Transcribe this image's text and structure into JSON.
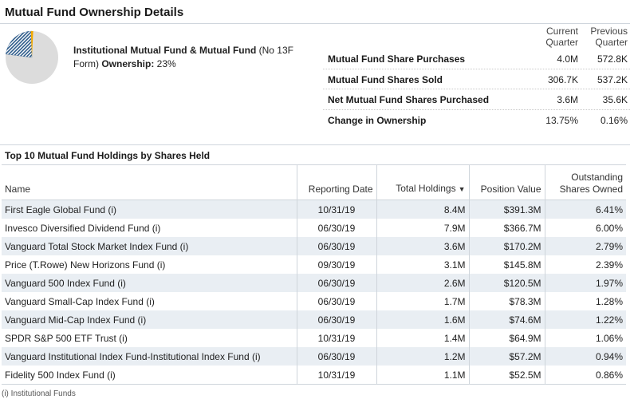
{
  "header": {
    "title": "Mutual Fund Ownership Details"
  },
  "ownership": {
    "label_bold": "Institutional Mutual Fund & Mutual Fund",
    "label_normal": " (No 13F Form) ",
    "label_suffix": "Ownership:",
    "value": " 23%",
    "share_fraction": 0.23,
    "colors": {
      "main": "#dcdcdc",
      "hatch": "#2d5b8a",
      "accent": "#f2a900"
    }
  },
  "summary": {
    "col_current": "Current Quarter",
    "col_current_l1": "Current",
    "col_current_l2": "Quarter",
    "col_previous_l1": "Previous",
    "col_previous_l2": "Quarter",
    "rows": [
      {
        "label": "Mutual Fund Share Purchases",
        "current": "4.0M",
        "previous": "572.8K"
      },
      {
        "label": "Mutual Fund Shares Sold",
        "current": "306.7K",
        "previous": "537.2K"
      },
      {
        "label": "Net Mutual Fund Shares Purchased",
        "current": "3.6M",
        "previous": "35.6K"
      },
      {
        "label": "Change in Ownership",
        "current": "13.75%",
        "previous": "0.16%"
      }
    ]
  },
  "holdings": {
    "title": "Top 10 Mutual Fund Holdings by Shares Held",
    "columns": {
      "name": "Name",
      "date": "Reporting Date",
      "total": "Total Holdings",
      "value": "Position Value",
      "outstanding_l1": "Outstanding",
      "outstanding_l2": "Shares Owned"
    },
    "sort_icon": "sort-down-icon",
    "rows": [
      {
        "name": "First Eagle Global Fund (i)",
        "date": "10/31/19",
        "total": "8.4M",
        "value": "$391.3M",
        "pct": "6.41%"
      },
      {
        "name": "Invesco Diversified Dividend Fund (i)",
        "date": "06/30/19",
        "total": "7.9M",
        "value": "$366.7M",
        "pct": "6.00%"
      },
      {
        "name": "Vanguard Total Stock Market Index Fund (i)",
        "date": "06/30/19",
        "total": "3.6M",
        "value": "$170.2M",
        "pct": "2.79%"
      },
      {
        "name": "Price (T.Rowe) New Horizons Fund (i)",
        "date": "09/30/19",
        "total": "3.1M",
        "value": "$145.8M",
        "pct": "2.39%"
      },
      {
        "name": "Vanguard 500 Index Fund (i)",
        "date": "06/30/19",
        "total": "2.6M",
        "value": "$120.5M",
        "pct": "1.97%"
      },
      {
        "name": "Vanguard Small-Cap Index Fund (i)",
        "date": "06/30/19",
        "total": "1.7M",
        "value": "$78.3M",
        "pct": "1.28%"
      },
      {
        "name": "Vanguard Mid-Cap Index Fund (i)",
        "date": "06/30/19",
        "total": "1.6M",
        "value": "$74.6M",
        "pct": "1.22%"
      },
      {
        "name": "SPDR S&P 500 ETF Trust (i)",
        "date": "10/31/19",
        "total": "1.4M",
        "value": "$64.9M",
        "pct": "1.06%"
      },
      {
        "name": "Vanguard Institutional Index Fund-Institutional Index Fund (i)",
        "date": "06/30/19",
        "total": "1.2M",
        "value": "$57.2M",
        "pct": "0.94%"
      },
      {
        "name": "Fidelity 500 Index Fund (i)",
        "date": "10/31/19",
        "total": "1.1M",
        "value": "$52.5M",
        "pct": "0.86%"
      }
    ]
  },
  "footnote": "(i) Institutional Funds"
}
